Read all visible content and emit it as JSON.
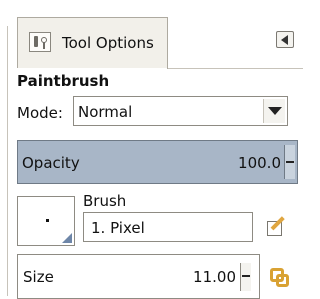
{
  "panel": {
    "tab_label": "Tool Options",
    "tab_icon": "tool-options-icon",
    "menu_icon": "left-arrow-menu-icon"
  },
  "tool": {
    "title": "Paintbrush",
    "mode_label": "Mode:",
    "mode_value": "Normal",
    "opacity_label": "Opacity",
    "opacity_value": "100.0",
    "brush_label": "Brush",
    "brush_value": "1. Pixel",
    "size_label": "Size",
    "size_value": "11.00"
  },
  "colors": {
    "opacity_bg": "#a8b6c7",
    "tab_bg": "#f2f0ea"
  }
}
